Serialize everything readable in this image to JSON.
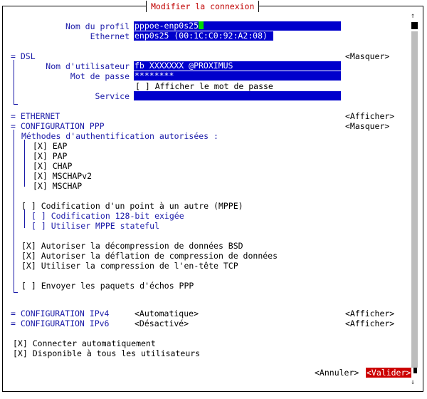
{
  "window": {
    "title": "Modifier la connexion"
  },
  "profile": {
    "name_label": "Nom du profil",
    "name_value": "pppoe-enp0s25",
    "device_label": "Ethernet",
    "device_value": "enp0s25 (00:1C:C0:92:A2:08)"
  },
  "dsl": {
    "header": "= DSL",
    "toggle": "<Masquer>",
    "user_label": "Nom d'utilisateur",
    "user_value": "fb XXXXXXX @PROXIMUS",
    "pass_label": "Mot de passe",
    "pass_value": "********",
    "show_pass": "[ ] Afficher le mot de passe",
    "service_label": "Service",
    "service_value": ""
  },
  "ethernet": {
    "header": "= ETHERNET",
    "toggle": "<Afficher>"
  },
  "ppp": {
    "header": "= CONFIGURATION PPP",
    "toggle": "<Masquer>",
    "auth_title": "Méthodes d'authentification autorisées :",
    "auth_methods": [
      "[X] EAP",
      "[X] PAP",
      "[X] CHAP",
      "[X] MSCHAPv2",
      "[X] MSCHAP"
    ],
    "mppe": "[ ] Codification d'un point à un autre (MPPE)",
    "mppe_128": "[ ] Codification 128-bit exigée",
    "mppe_stateful": "[ ] Utiliser MPPE stateful",
    "bsd": "[X] Autoriser la décompression de données BSD",
    "deflate": "[X] Autoriser la déflation de compression de données",
    "tcp_header": "[X] Utiliser la compression de l'en-tête TCP",
    "echo": "[ ] Envoyer les paquets d'échos PPP"
  },
  "ipv4": {
    "header": "= CONFIGURATION IPv4",
    "mode": "<Automatique>",
    "toggle": "<Afficher>"
  },
  "ipv6": {
    "header": "= CONFIGURATION IPv6",
    "mode": "<Désactivé>",
    "toggle": "<Afficher>"
  },
  "auto_connect": "[X] Connecter automatiquement",
  "all_users": "[X] Disponible à tous les utilisateurs",
  "buttons": {
    "cancel": "<Annuler>",
    "ok": "<Valider>"
  },
  "colors": {
    "label": "#1a1aa8",
    "field_bg": "#0000cc",
    "title": "#c00000",
    "ok_bg": "#cc0000",
    "cursor": "#00dd00"
  }
}
